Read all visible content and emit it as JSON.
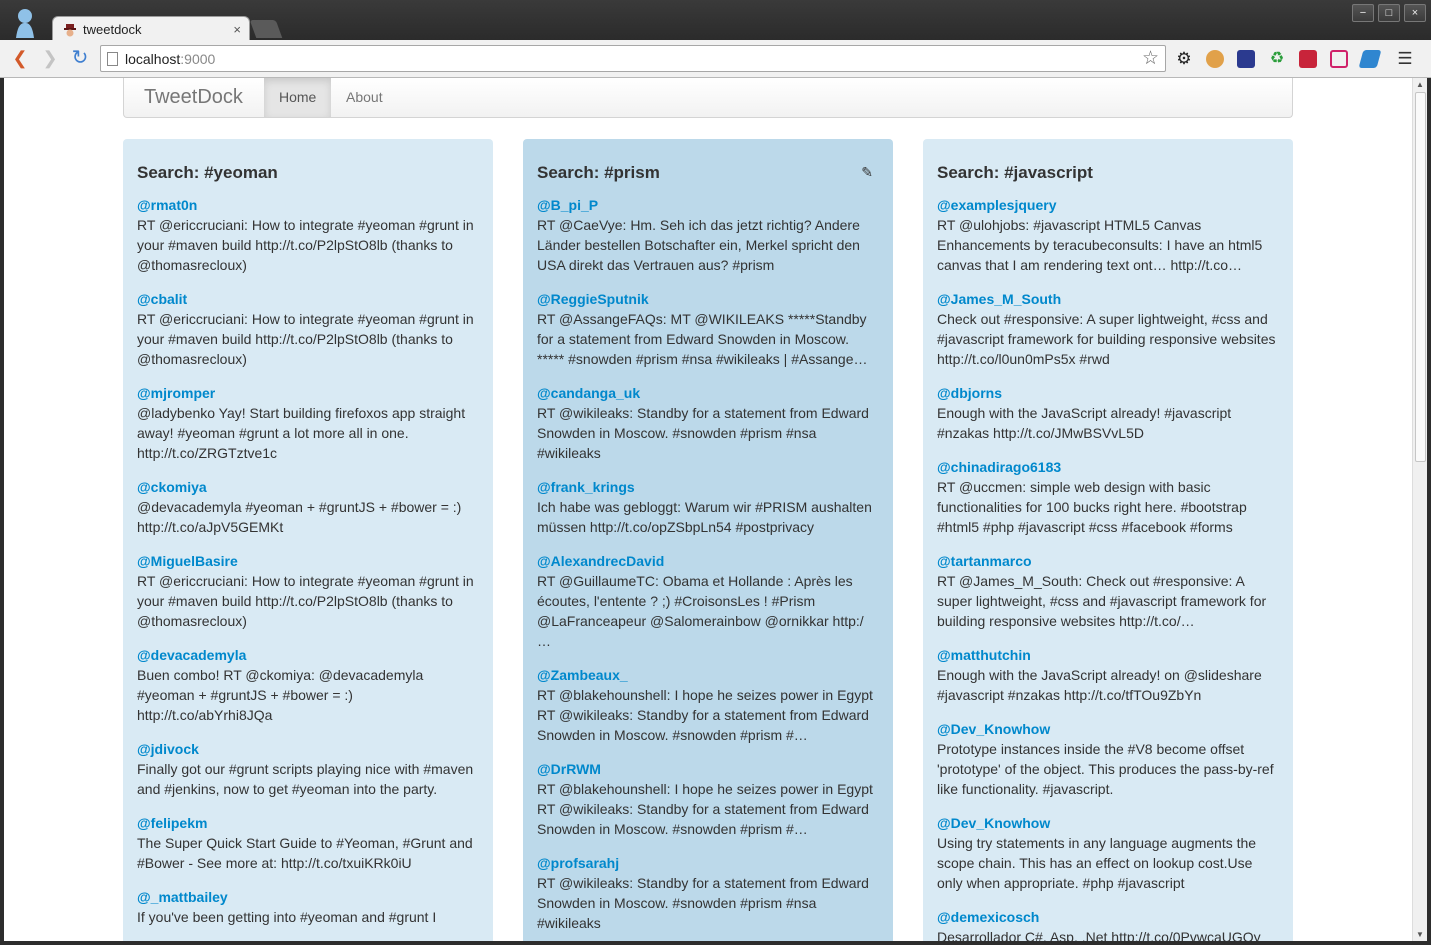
{
  "browser": {
    "tab_title": "tweetdock",
    "tab_close": "×",
    "url_host": "localhost",
    "url_port": ":9000",
    "window_buttons": [
      "−",
      "□",
      "×"
    ]
  },
  "navbar": {
    "brand": "TweetDock",
    "links": [
      "Home",
      "About"
    ]
  },
  "columns": [
    {
      "title": "Search: #yeoman",
      "tweets": [
        {
          "user": "@rmat0n",
          "text": "RT @ericcruciani: How to integrate #yeoman #grunt in your #maven build http://t.co/P2lpStO8lb (thanks to @thomasrecloux)"
        },
        {
          "user": "@cbalit",
          "text": "RT @ericcruciani: How to integrate #yeoman #grunt in your #maven build http://t.co/P2lpStO8lb (thanks to @thomasrecloux)"
        },
        {
          "user": "@mjromper",
          "text": "@ladybenko Yay! Start building firefoxos app straight away! #yeoman #grunt a lot more all in one. http://t.co/ZRGTztve1c"
        },
        {
          "user": "@ckomiya",
          "text": "@devacademyla #yeoman + #gruntJS + #bower = :) http://t.co/aJpV5GEMKt"
        },
        {
          "user": "@MiguelBasire",
          "text": "RT @ericcruciani: How to integrate #yeoman #grunt in your #maven build http://t.co/P2lpStO8lb (thanks to @thomasrecloux)"
        },
        {
          "user": "@devacademyla",
          "text": "Buen combo! RT @ckomiya: @devacademyla #yeoman + #gruntJS + #bower = :) http://t.co/abYrhi8JQa"
        },
        {
          "user": "@jdivock",
          "text": "Finally got our #grunt scripts playing nice with #maven and #jenkins, now to get #yeoman into the party."
        },
        {
          "user": "@felipekm",
          "text": "The Super Quick Start Guide to #Yeoman, #Grunt and #Bower - See more at: http://t.co/txuiKRk0iU"
        },
        {
          "user": "@_mattbailey",
          "text": "If you've been getting into #yeoman and #grunt I"
        }
      ]
    },
    {
      "title": "Search: #prism",
      "tweets": [
        {
          "user": "@B_pi_P",
          "text": "RT @CaeVye: Hm. Seh ich das jetzt richtig? Andere Länder bestellen Botschafter ein, Merkel spricht den USA direkt das Vertrauen aus? #prism"
        },
        {
          "user": "@ReggieSputnik",
          "text": "RT @AssangeFAQs: MT @WIKILEAKS *****Standby for a statement from Edward Snowden in Moscow. ***** #snowden #prism #nsa #wikileaks | #Assange…"
        },
        {
          "user": "@candanga_uk",
          "text": "RT @wikileaks: Standby for a statement from Edward Snowden in Moscow. #snowden #prism #nsa #wikileaks"
        },
        {
          "user": "@frank_krings",
          "text": "Ich habe was gebloggt: Warum wir #PRISM aushalten müssen http://t.co/opZSbpLn54 #postprivacy"
        },
        {
          "user": "@AlexandrecDavid",
          "text": "RT @GuillaumeTC: Obama et Hollande : Après les écoutes, l'entente ? ;) #CroisonsLes ! #Prism @LaFranceapeur @Salomerainbow @ornikkar http:/ …"
        },
        {
          "user": "@Zambeaux_",
          "text": "RT @blakehounshell: I hope he seizes power in Egypt RT @wikileaks: Standby for a statement from Edward Snowden in Moscow. #snowden #prism #…"
        },
        {
          "user": "@DrRWM",
          "text": "RT @blakehounshell: I hope he seizes power in Egypt RT @wikileaks: Standby for a statement from Edward Snowden in Moscow. #snowden #prism #…"
        },
        {
          "user": "@profsarahj",
          "text": "RT @wikileaks: Standby for a statement from Edward Snowden in Moscow. #snowden #prism #nsa #wikileaks"
        }
      ]
    },
    {
      "title": "Search: #javascript",
      "tweets": [
        {
          "user": "@examplesjquery",
          "text": "RT @ulohjobs: #javascript HTML5 Canvas Enhancements by teracubeconsults: I have an html5 canvas that I am rendering text ont… http://t.co…"
        },
        {
          "user": "@James_M_South",
          "text": "Check out #responsive: A super lightweight, #css and #javascript framework for building responsive websites http://t.co/l0un0mPs5x #rwd"
        },
        {
          "user": "@dbjorns",
          "text": "Enough with the JavaScript already! #javascript #nzakas http://t.co/JMwBSVvL5D"
        },
        {
          "user": "@chinadirago6183",
          "text": "RT @uccmen: simple web design with basic functionalities for 100 bucks right here. #bootstrap #html5 #php #javascript #css #facebook #forms"
        },
        {
          "user": "@tartanmarco",
          "text": "RT @James_M_South: Check out #responsive: A super lightweight, #css and #javascript framework for building responsive websites http://t.co/…"
        },
        {
          "user": "@matthutchin",
          "text": "Enough with the JavaScript already! on @slideshare #javascript #nzakas http://t.co/tfTOu9ZbYn"
        },
        {
          "user": "@Dev_Knowhow",
          "text": "Prototype instances inside the #V8 become offset 'prototype' of the object. This produces the pass-by-ref like functionality. #javascript."
        },
        {
          "user": "@Dev_Knowhow",
          "text": "Using try statements in any language augments the scope chain. This has an effect on lookup cost.Use only when appropriate. #php #javascript"
        },
        {
          "user": "@demexicosch",
          "text": "Desarrollador C#, Asp, .Net http://t.co/0PvwcaUGOy"
        }
      ]
    }
  ],
  "colors": {
    "column_bg": "#d9eaf4",
    "column_active_bg": "#bcd9ea",
    "link": "#0088cc"
  },
  "icons": [
    "profile-icon",
    "back-icon",
    "forward-icon",
    "reload-icon",
    "page-icon",
    "bookmark-star-icon",
    "edit-icon"
  ]
}
